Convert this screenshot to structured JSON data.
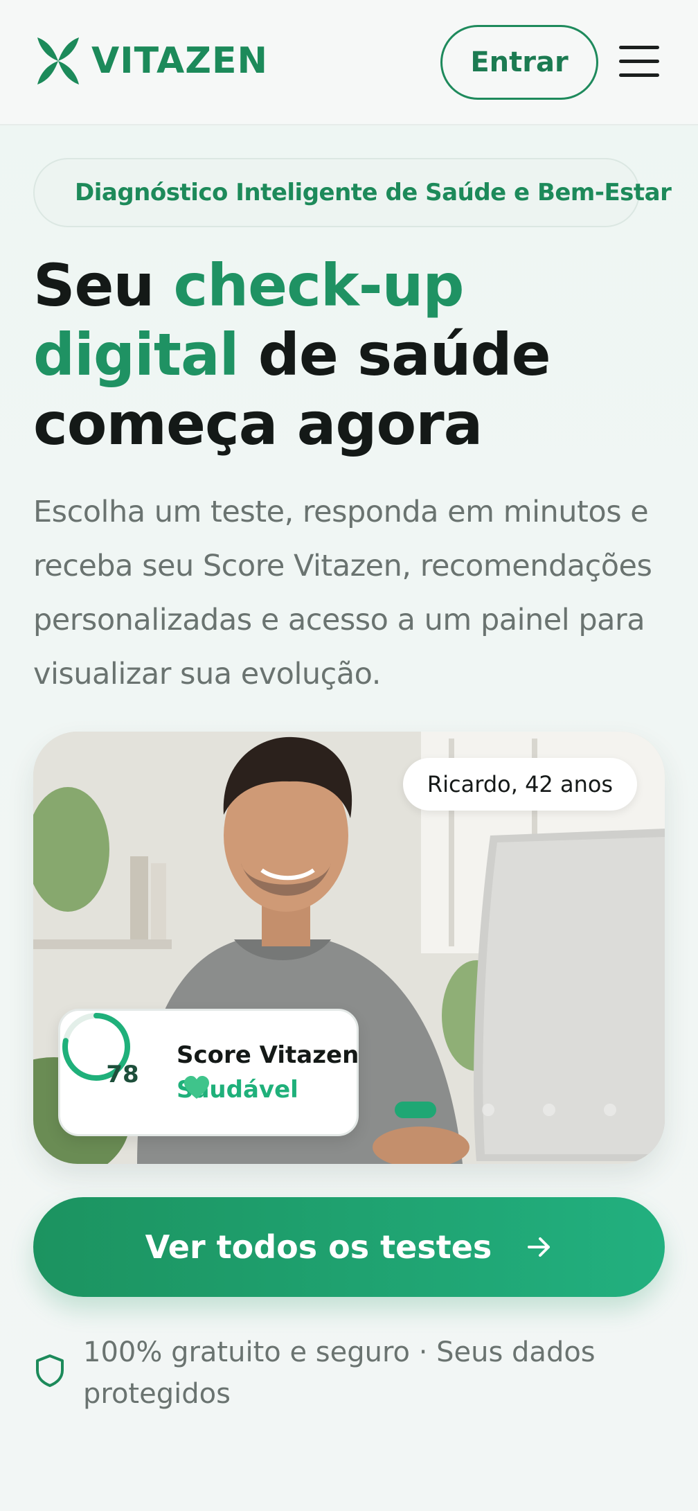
{
  "header": {
    "brand": "VITAZEN",
    "login_label": "Entrar",
    "brand_color": "#1c8a5a"
  },
  "badge": {
    "text": "Diagnóstico Inteligente de Saúde e Bem-Estar"
  },
  "hero": {
    "headline_before": "Seu ",
    "headline_accent": "check-up digital",
    "headline_after": " de saúde começa agora",
    "subtext": "Escolha um teste, responda em minutos e receba seu Score Vitazen, recomendações personalizadas e acesso a um painel para visualizar sua evolução.",
    "person_tag": "Ricardo, 42 anos",
    "score": {
      "value": "78",
      "fraction": 0.78,
      "label": "Score Vitazen",
      "status": "Saudável"
    },
    "carousel": {
      "slides": 4,
      "active": 1
    }
  },
  "cta": {
    "label": "Ver todos os testes"
  },
  "trust": {
    "text": "100% gratuito e seguro · Seus dados protegidos"
  },
  "colors": {
    "accent": "#1f9263",
    "cta_start": "#1c9360",
    "cta_end": "#22b07f",
    "muted_text": "#6a7370"
  },
  "icons": {
    "logo": "vitazen-leaf-logo-icon",
    "menu": "hamburger-menu-icon",
    "arrow": "arrow-right-icon",
    "shield": "shield-icon",
    "heart": "green-heart-icon"
  }
}
